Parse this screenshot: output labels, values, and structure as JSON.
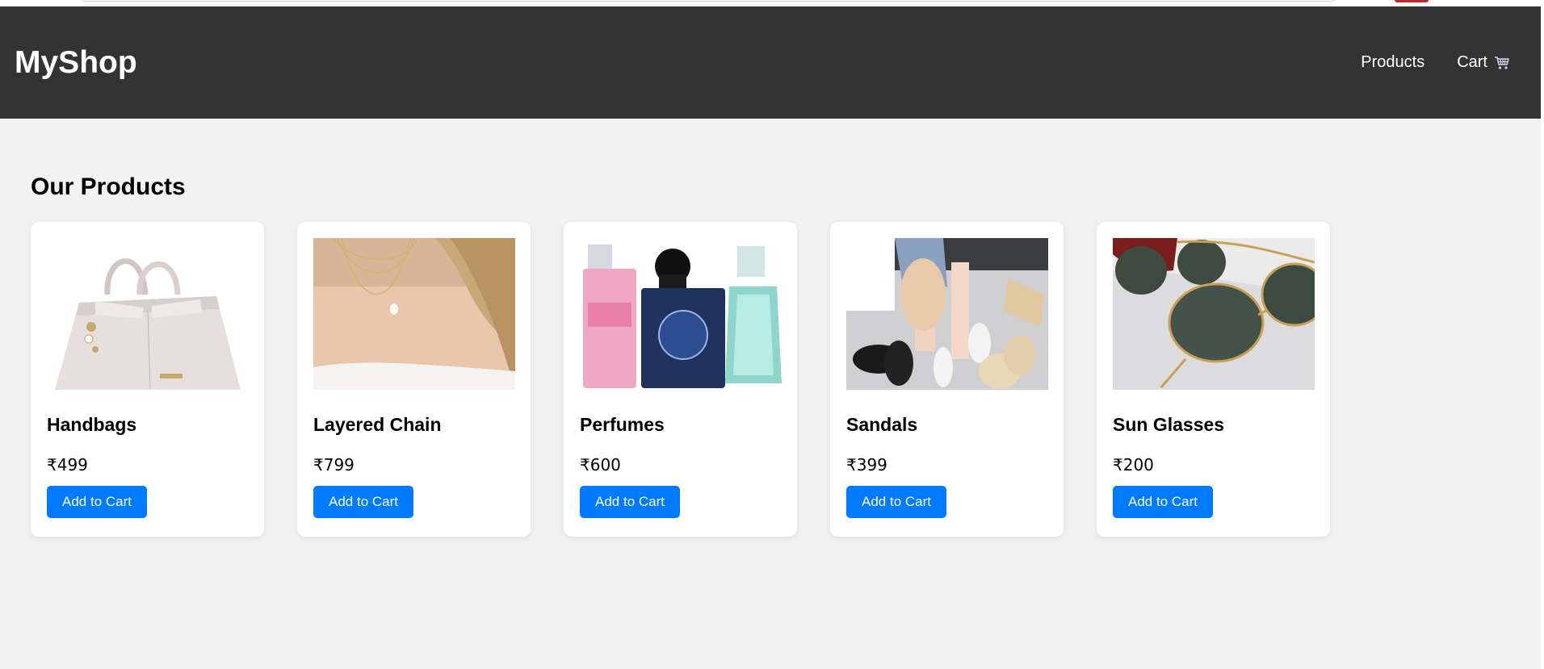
{
  "header": {
    "logo": "MyShop",
    "nav": [
      {
        "label": "Products"
      },
      {
        "label": "Cart"
      }
    ]
  },
  "main": {
    "heading": "Our Products",
    "button_label": "Add to Cart",
    "products": [
      {
        "name": "Handbags",
        "price": "₹499"
      },
      {
        "name": "Layered Chain",
        "price": "₹799"
      },
      {
        "name": "Perfumes",
        "price": "₹600"
      },
      {
        "name": "Sandals",
        "price": "₹399"
      },
      {
        "name": "Sun Glasses",
        "price": "₹200"
      }
    ]
  },
  "colors": {
    "header_bg": "#333333",
    "page_bg": "#f2f2f2",
    "button_bg": "#007bff",
    "card_bg": "#ffffff"
  },
  "icons": {
    "cart": "shopping-cart-icon"
  }
}
